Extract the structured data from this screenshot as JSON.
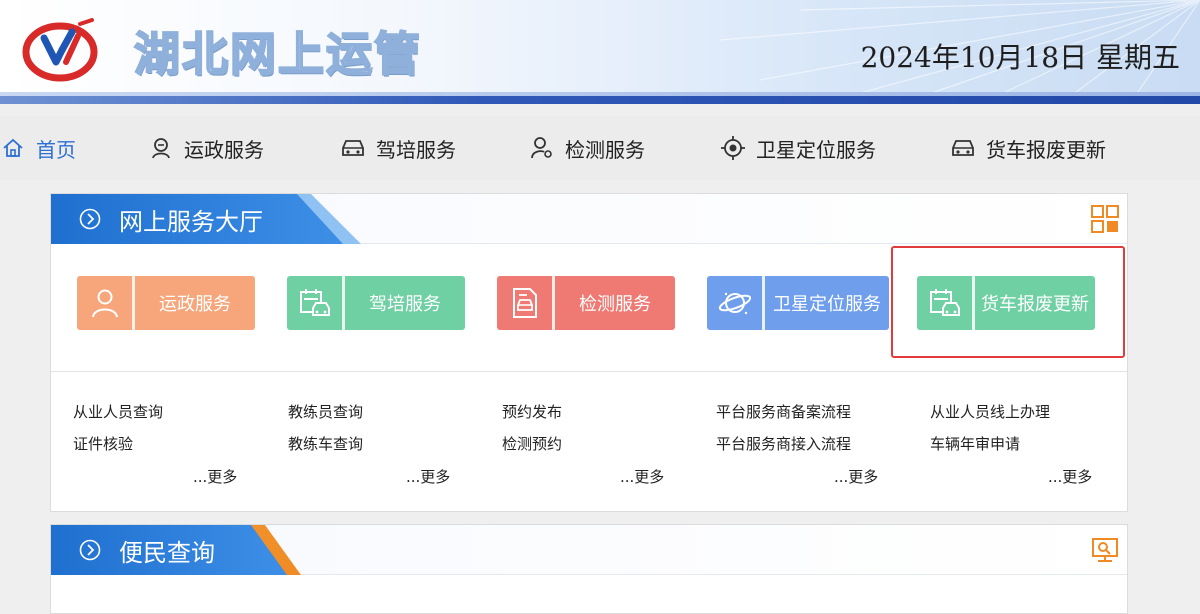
{
  "header": {
    "site_title": "湖北网上运管",
    "date": "2024年10月18日 星期五"
  },
  "nav": {
    "items": [
      {
        "label": "首页",
        "icon": "home-icon"
      },
      {
        "label": "运政服务",
        "icon": "user-service-icon"
      },
      {
        "label": "驾培服务",
        "icon": "car-icon"
      },
      {
        "label": "检测服务",
        "icon": "inspect-person-icon"
      },
      {
        "label": "卫星定位服务",
        "icon": "target-icon"
      },
      {
        "label": "货车报废更新",
        "icon": "truck-icon"
      }
    ]
  },
  "service_hall": {
    "title": "网上服务大厅",
    "tiles": [
      {
        "label": "运政服务",
        "color": "#f6a67a",
        "icon": "person-icon"
      },
      {
        "label": "驾培服务",
        "color": "#6fd0a4",
        "icon": "calendar-car-icon"
      },
      {
        "label": "检测服务",
        "color": "#ef7a73",
        "icon": "document-car-icon"
      },
      {
        "label": "卫星定位服务",
        "color": "#6e9eec",
        "icon": "planet-icon"
      },
      {
        "label": "货车报废更新",
        "color": "#6fd0a4",
        "icon": "calendar-car-icon"
      }
    ],
    "highlight_color": "#e23b3b",
    "link_columns": [
      {
        "links": [
          "从业人员查询",
          "证件核验"
        ],
        "more": "...更多"
      },
      {
        "links": [
          "教练员查询",
          "教练车查询"
        ],
        "more": "...更多"
      },
      {
        "links": [
          "预约发布",
          "检测预约"
        ],
        "more": "...更多"
      },
      {
        "links": [
          "平台服务商备案流程",
          "平台服务商接入流程"
        ],
        "more": "...更多"
      },
      {
        "links": [
          "从业人员线上办理",
          "车辆年审申请"
        ],
        "more": "...更多"
      }
    ]
  },
  "convenience": {
    "title": "便民查询"
  },
  "colors": {
    "nav_active": "#2d6fd3",
    "tab_blue": "#1f6fd0",
    "corner_orange": "#f08a24"
  }
}
